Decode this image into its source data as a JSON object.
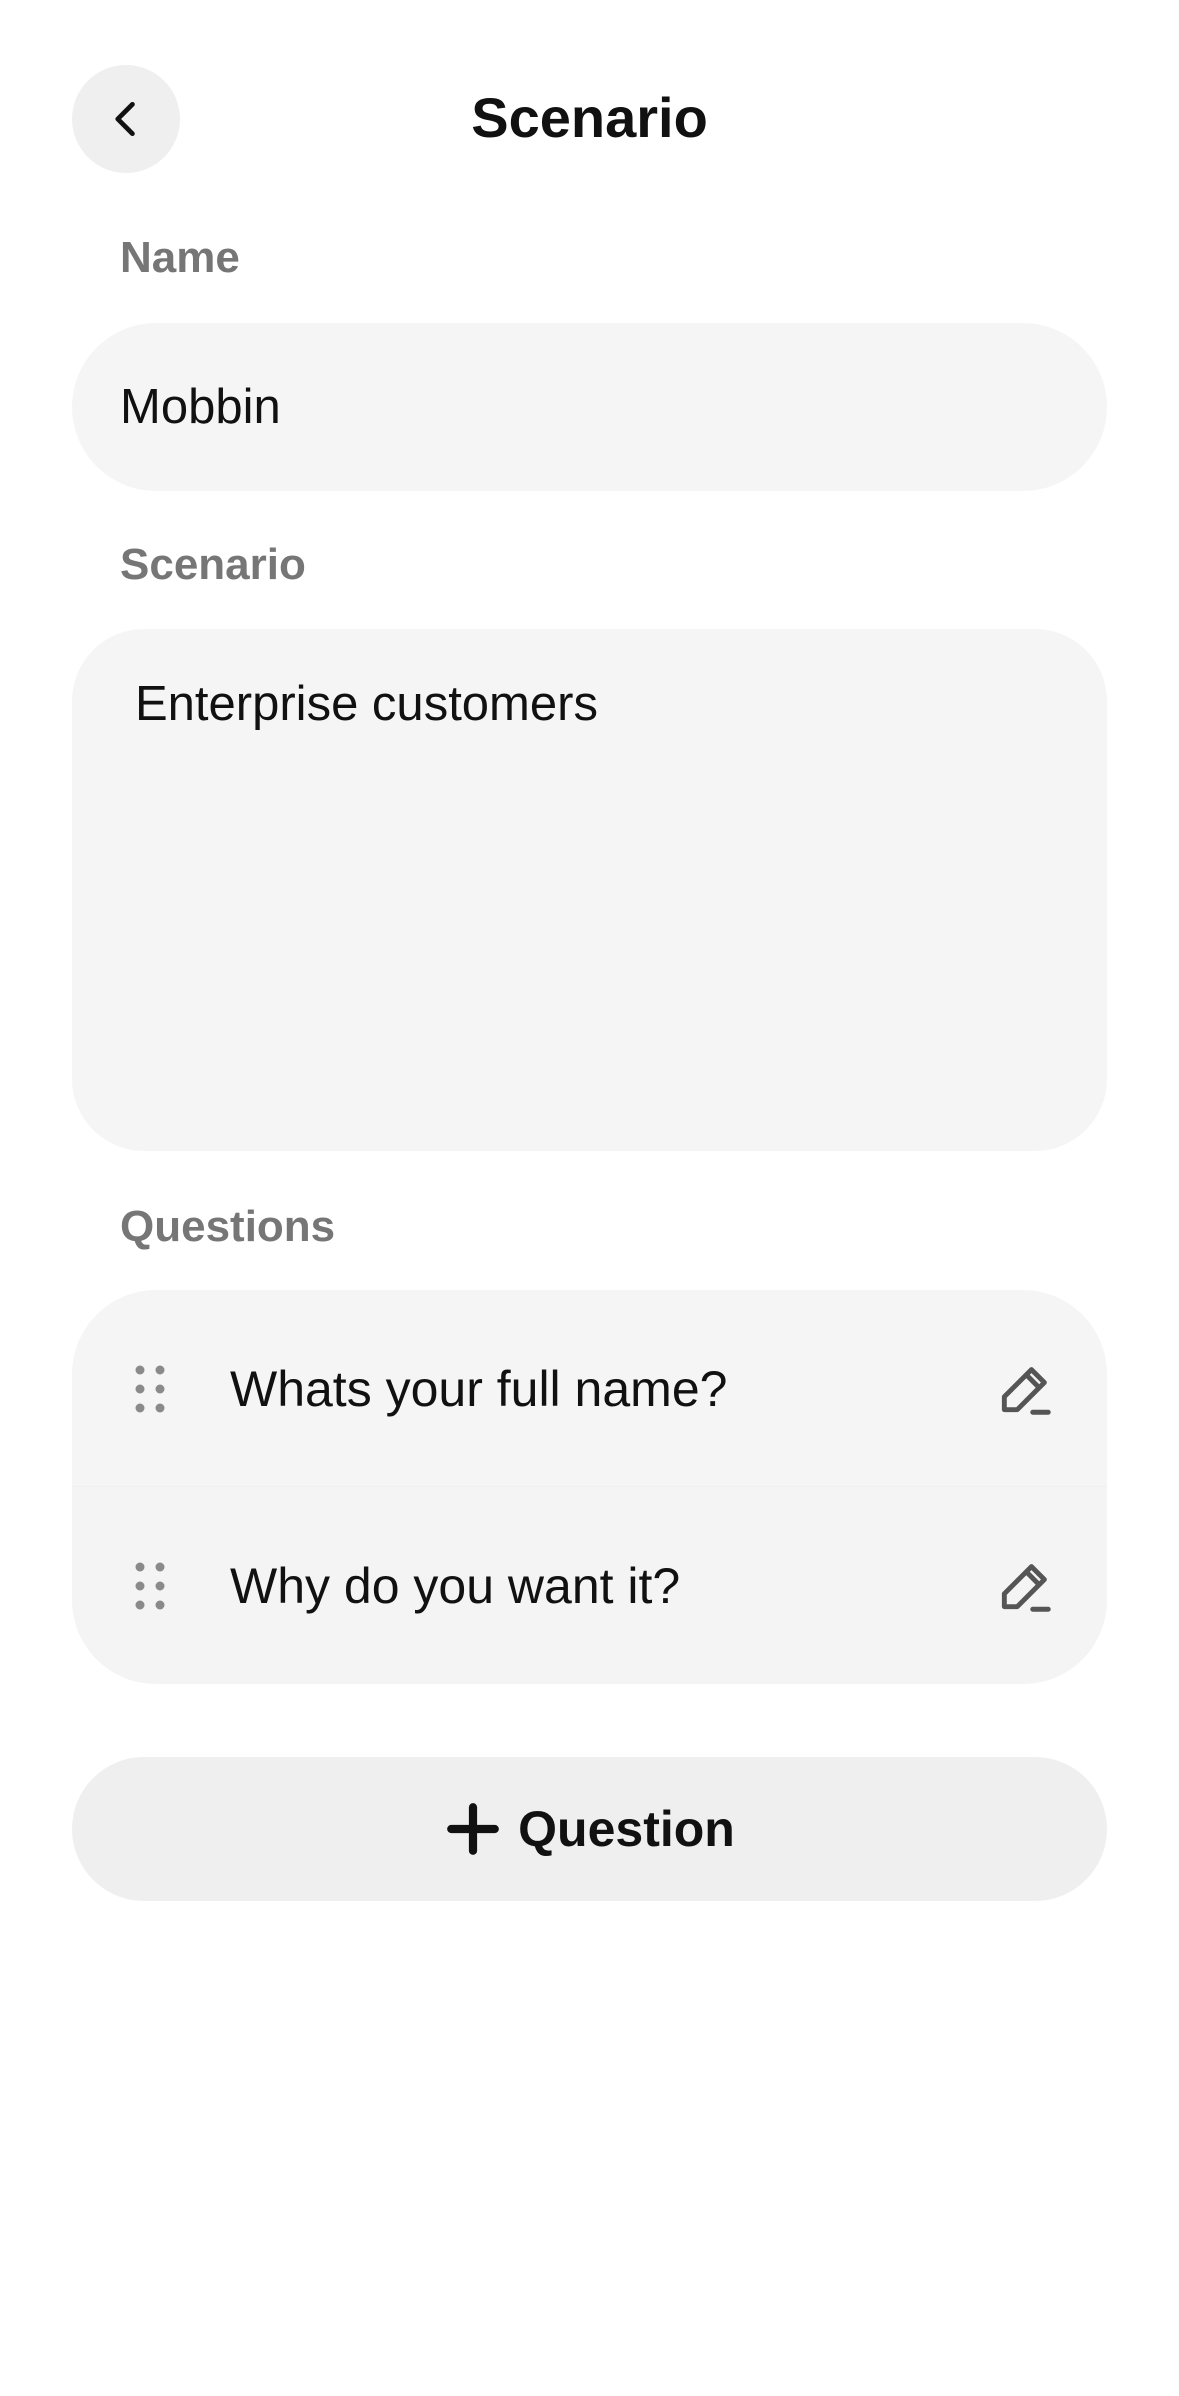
{
  "header": {
    "title": "Scenario",
    "back_icon": "chevron-left-icon"
  },
  "form": {
    "name_label": "Name",
    "name_value": "Mobbin",
    "scenario_label": "Scenario",
    "scenario_value": "Enterprise customers",
    "questions_label": "Questions"
  },
  "questions": [
    {
      "text": "Whats your full name?",
      "drag_icon": "drag-handle-icon",
      "edit_icon": "pencil-icon"
    },
    {
      "text": "Why do you want it?",
      "drag_icon": "drag-handle-icon",
      "edit_icon": "pencil-icon"
    }
  ],
  "add_question": {
    "label": "Question",
    "icon": "plus-icon"
  },
  "colors": {
    "background": "#ffffff",
    "surface": "#f5f5f5",
    "button_surface": "#efefef",
    "text_primary": "#111111",
    "text_label": "#767676",
    "icon_muted": "#8a8a8a"
  }
}
